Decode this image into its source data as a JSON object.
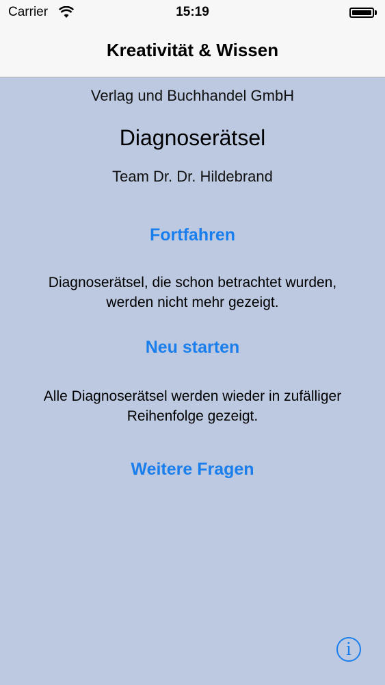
{
  "status_bar": {
    "carrier": "Carrier",
    "time": "15:19",
    "wifi_icon": "wifi-icon",
    "battery_icon": "battery-icon",
    "battery_level": 1.0
  },
  "nav": {
    "title": "Kreativität & Wissen"
  },
  "main": {
    "publisher": "Verlag und Buchhandel GmbH",
    "title": "Diagnoserätsel",
    "team": "Team Dr. Dr. Hildebrand",
    "continue_label": "Fortfahren",
    "continue_desc": "Diagnoserätsel, die schon betrachtet wurden, werden nicht mehr gezeigt.",
    "restart_label": "Neu starten",
    "restart_desc": "Alle Diagnoserätsel werden wieder in zufälliger Reihenfolge gezeigt.",
    "more_label": "Weitere Fragen",
    "info_glyph": "i",
    "info_icon": "info-icon"
  },
  "colors": {
    "background": "#bcc9e0",
    "bar_background": "#f7f7f7",
    "accent": "#1a7fec"
  }
}
